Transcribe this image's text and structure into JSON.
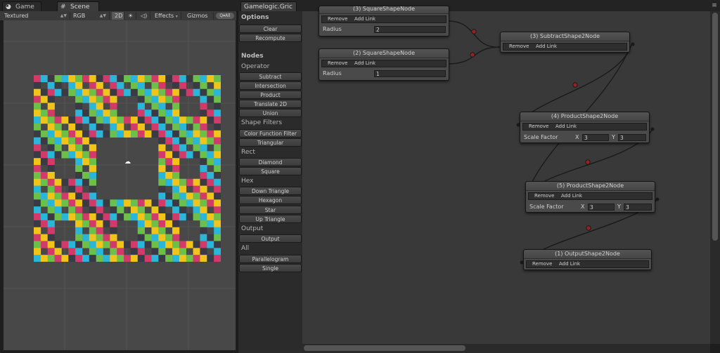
{
  "tabs": {
    "game": {
      "label": "Game",
      "icon": "pacman-icon"
    },
    "scene": {
      "label": "Scene",
      "icon": "grid-icon"
    },
    "graph": {
      "label": "Gamelogic.Gric"
    }
  },
  "scene_toolbar": {
    "shading_mode": "Textured",
    "render_mode": "RGB",
    "mode_2d": "2D",
    "effects": "Effects",
    "gizmos": "Gizmos",
    "search_placeholder": "Q▾All"
  },
  "left_panel": {
    "options_header": "Options",
    "options_buttons": [
      "Clear",
      "Recompute"
    ],
    "nodes_header": "Nodes",
    "groups": [
      {
        "name": "Operator",
        "items": [
          "Subtract",
          "Intersection",
          "Product",
          "Translate 2D",
          "Union"
        ]
      },
      {
        "name": "Shape Filters",
        "items": [
          "Color Function Filter",
          "Triangular"
        ]
      },
      {
        "name": "Rect",
        "items": [
          "Diamond",
          "Square"
        ]
      },
      {
        "name": "Hex",
        "items": [
          "Down Triangle",
          "Hexagon",
          "Star",
          "Up Triangle"
        ]
      },
      {
        "name": "Output",
        "items": [
          "Output"
        ]
      },
      {
        "name": "All",
        "items": [
          "Parallelogram",
          "Single"
        ]
      }
    ]
  },
  "nodes": {
    "top_partial": {
      "title": "(3) SquareShapeNode",
      "remove": "Remove",
      "add_link": "Add Link",
      "radius_label": "Radius",
      "radius_value": "2"
    },
    "square2": {
      "title": "(2) SquareShapeNode",
      "remove": "Remove",
      "add_link": "Add Link",
      "radius_label": "Radius",
      "radius_value": "1"
    },
    "subtract3": {
      "title": "(3) SubtractShape2Node",
      "remove": "Remove",
      "add_link": "Add Link"
    },
    "product4": {
      "title": "(4) ProductShape2Node",
      "remove": "Remove",
      "add_link": "Add Link",
      "scale_label": "Scale Factor",
      "x_label": "X",
      "x_value": "3",
      "y_label": "Y",
      "y_value": "3"
    },
    "product5": {
      "title": "(5) ProductShape2Node",
      "remove": "Remove",
      "add_link": "Add Link",
      "scale_label": "Scale Factor",
      "x_label": "X",
      "x_value": "3",
      "y_label": "Y",
      "y_value": "3"
    },
    "output1": {
      "title": "(1) OutputShape2Node",
      "remove": "Remove",
      "add_link": "Add Link"
    }
  },
  "colors": {
    "cell_colors": [
      "#d23a6a",
      "#f0c419",
      "#6cc04a",
      "#29b6d8",
      "#3a3a44"
    ],
    "wire": "#1a1a1a",
    "wire_knot": "#9a2020"
  }
}
